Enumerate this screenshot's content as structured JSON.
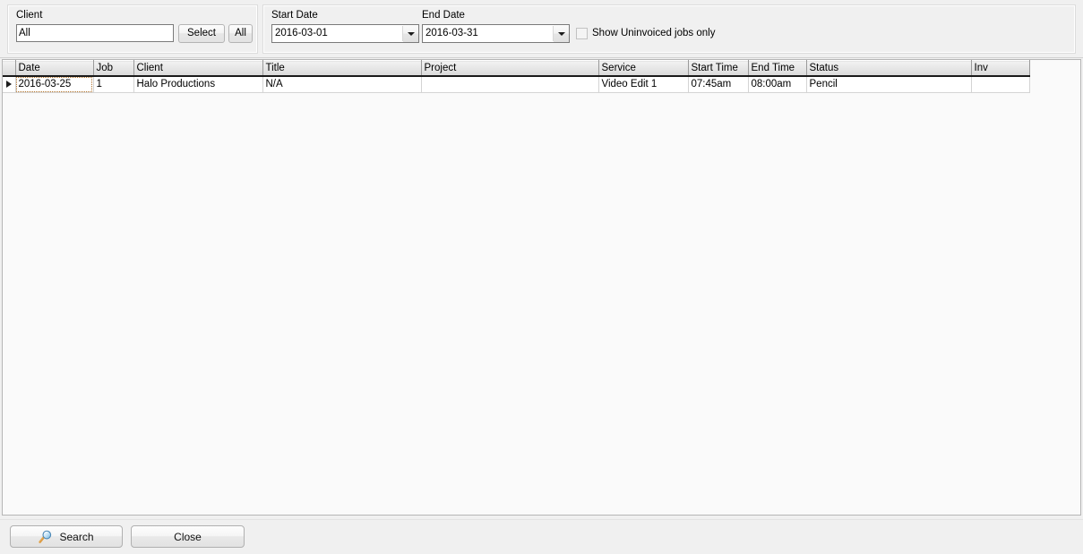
{
  "filters": {
    "client": {
      "label": "Client",
      "value": "All",
      "select_button": "Select",
      "all_button": "All"
    },
    "start_date": {
      "label": "Start Date",
      "value": "2016-03-01"
    },
    "end_date": {
      "label": "End Date",
      "value": "2016-03-31"
    },
    "uninvoiced_checkbox": {
      "label": "Show Uninvoiced jobs only",
      "checked": false
    }
  },
  "grid": {
    "columns": [
      "Date",
      "Job",
      "Client",
      "Title",
      "Project",
      "Service",
      "Start Time",
      "End Time",
      "Status",
      "Inv"
    ],
    "rows": [
      {
        "selected": true,
        "cells": {
          "date": "2016-03-25",
          "job": "1",
          "client": "Halo Productions",
          "title": "N/A",
          "project": "",
          "service": "Video Edit 1",
          "start_time": "07:45am",
          "end_time": "08:00am",
          "status": "Pencil",
          "inv": ""
        }
      }
    ]
  },
  "actions": {
    "search_label": "Search",
    "search_icon": "magnifier-icon",
    "close_label": "Close"
  },
  "colors": {
    "selection_blue": "#2f8ce8",
    "window_bg": "#f0f0f0",
    "grid_bg": "#fafafa",
    "header_gray": "#e4e4e4"
  }
}
